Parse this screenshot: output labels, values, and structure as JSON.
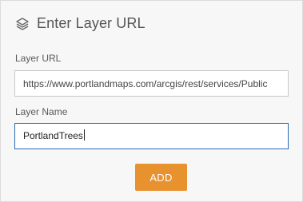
{
  "dialog": {
    "title": "Enter Layer URL",
    "title_icon": "layers-icon"
  },
  "form": {
    "url_label": "Layer URL",
    "url_value": "https://www.portlandmaps.com/arcgis/rest/services/Public",
    "name_label": "Layer Name",
    "name_value": "PortlandTrees"
  },
  "actions": {
    "add_label": "ADD"
  },
  "colors": {
    "accent": "#e8922f",
    "focus_border": "#2c6bb5",
    "panel_bg": "#f7f7f7"
  }
}
